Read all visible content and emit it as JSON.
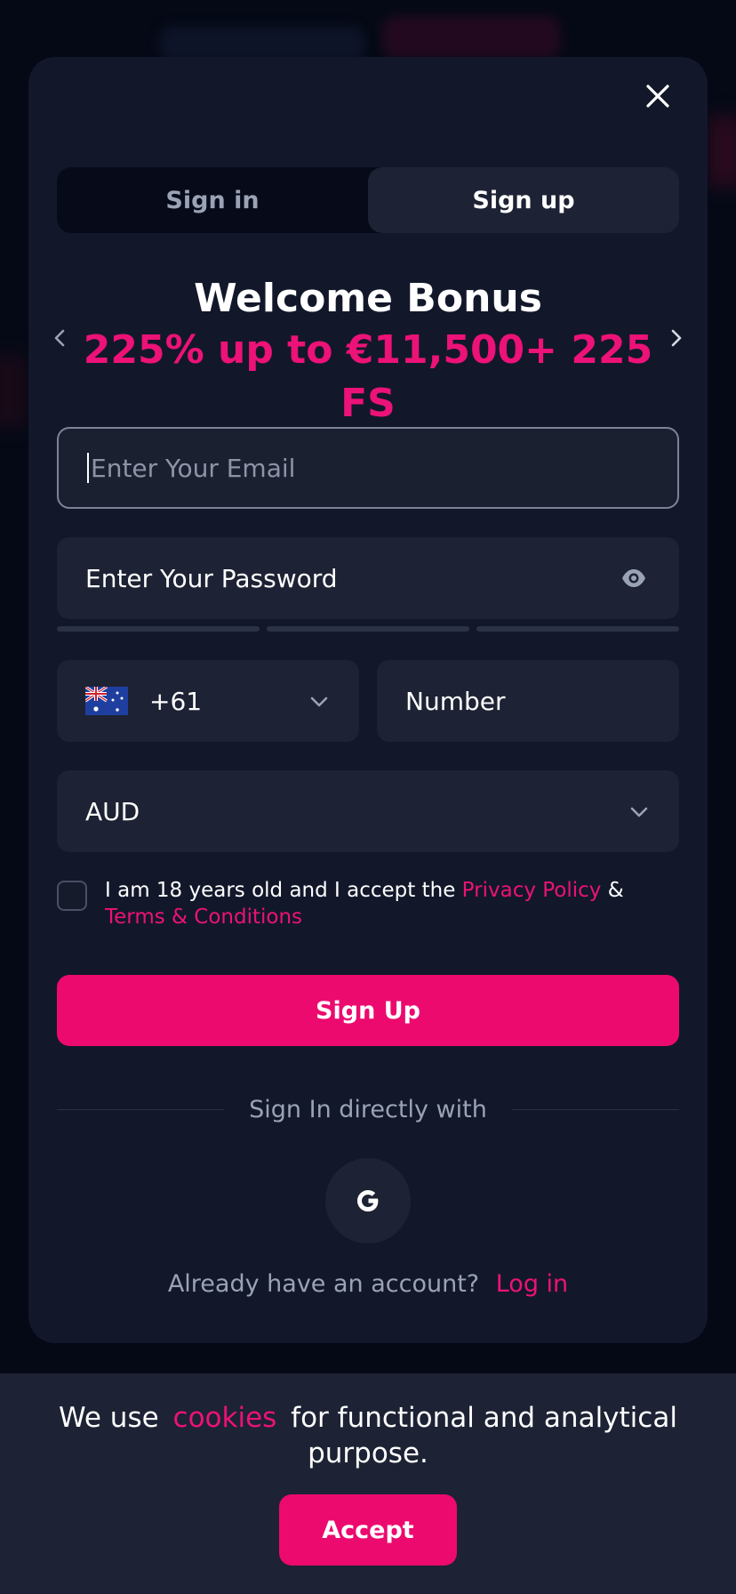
{
  "modal": {
    "tabs": [
      {
        "label": "Sign in",
        "active": false
      },
      {
        "label": "Sign up",
        "active": true
      }
    ],
    "promo": {
      "title": "Welcome Bonus",
      "subtitle": "225% up to €11,500+ 225 FS"
    },
    "email": {
      "placeholder": "Enter Your Email",
      "value": ""
    },
    "password": {
      "placeholder": "Enter Your Password"
    },
    "phone": {
      "country_icon": "australia-flag-icon",
      "code": "+61",
      "number_placeholder": "Number"
    },
    "currency": {
      "selected": "AUD"
    },
    "consent": {
      "text_before": "I am 18 years old and I accept the",
      "privacy_link": "Privacy Policy",
      "amp": "&",
      "terms_link": "Terms & Conditions"
    },
    "signup_button": "Sign Up",
    "social": {
      "label": "Sign In directly with",
      "google_icon": "google-icon"
    },
    "footer": {
      "text": "Already have an account?",
      "login_link": "Log in"
    }
  },
  "cookie": {
    "text_before": "We use",
    "link": "cookies",
    "text_after": "for functional and analytical purpose.",
    "accept_button": "Accept"
  },
  "colors": {
    "accent": "#ec0a6f",
    "modal_bg": "#12182a",
    "field_bg": "#1d2234",
    "muted_text": "#9aa2b6"
  }
}
